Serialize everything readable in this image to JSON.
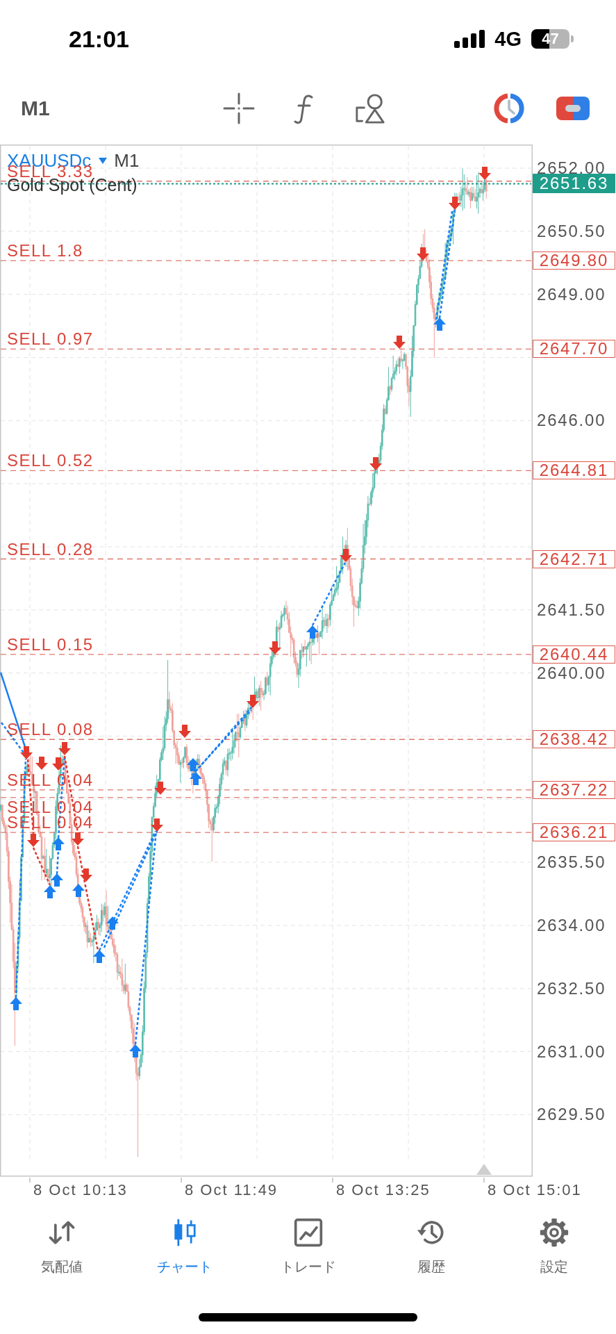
{
  "status_bar": {
    "time": "21:01",
    "network": "4G",
    "battery": "47"
  },
  "toolbar": {
    "timeframe": "M1"
  },
  "chart": {
    "symbol": "XAUUSDc",
    "timeframe": "M1",
    "description": "Gold Spot (Cent)",
    "current_price": "2651.63",
    "orders": [
      {
        "label": "SELL 3.33"
      },
      {
        "label": "SELL 1.8",
        "price": "2649.80"
      },
      {
        "label": "SELL 0.97",
        "price": "2647.70"
      },
      {
        "label": "SELL 0.52",
        "price": "2644.81"
      },
      {
        "label": "SELL 0.28",
        "price": "2642.71"
      },
      {
        "label": "SELL 0.15",
        "price": "2640.44"
      },
      {
        "label": "SELL 0.08",
        "price": "2638.42"
      },
      {
        "label": "SELL 0.04",
        "price": "2637.22"
      },
      {
        "label": "SELL 0.04"
      },
      {
        "label": "SELL 0.04",
        "price": "2636.21"
      }
    ],
    "price_ticks": [
      "2652.00",
      "2650.50",
      "2649.00",
      "2646.00",
      "2641.50",
      "2640.00",
      "2635.50",
      "2634.00",
      "2632.50",
      "2631.00",
      "2629.50"
    ],
    "time_ticks": [
      "8 Oct 10:13",
      "8 Oct 11:49",
      "8 Oct 13:25",
      "8 Oct 15:01"
    ]
  },
  "nav": [
    {
      "label": "気配値",
      "selected": false
    },
    {
      "label": "チャート",
      "selected": true
    },
    {
      "label": "トレード",
      "selected": false
    },
    {
      "label": "履歴",
      "selected": false
    },
    {
      "label": "設定",
      "selected": false
    }
  ]
}
